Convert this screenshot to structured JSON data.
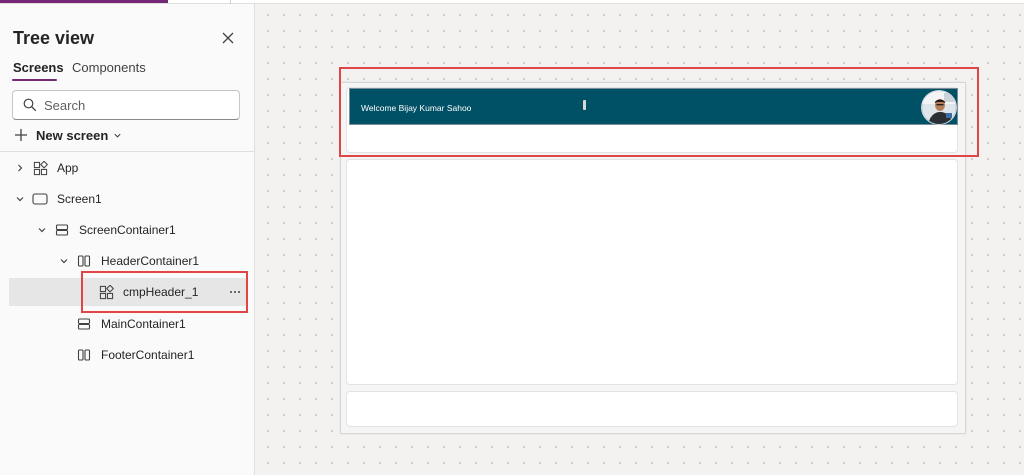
{
  "pane": {
    "title": "Tree view",
    "tabs": [
      {
        "label": "Screens",
        "active": true
      },
      {
        "label": "Components",
        "active": false
      }
    ],
    "search_placeholder": "Search",
    "new_screen_label": "New screen"
  },
  "tree": {
    "app": "App",
    "screen1": "Screen1",
    "screen_container": "ScreenContainer1",
    "header_container": "HeaderContainer1",
    "cmp_header": "cmpHeader_1",
    "main_container": "MainContainer1",
    "footer_container": "FooterContainer1"
  },
  "canvas": {
    "welcome_text": "Welcome Bijay Kumar Sahoo"
  },
  "colors": {
    "accent": "#742774",
    "header_bar": "#005066",
    "highlight": "#e04646"
  }
}
